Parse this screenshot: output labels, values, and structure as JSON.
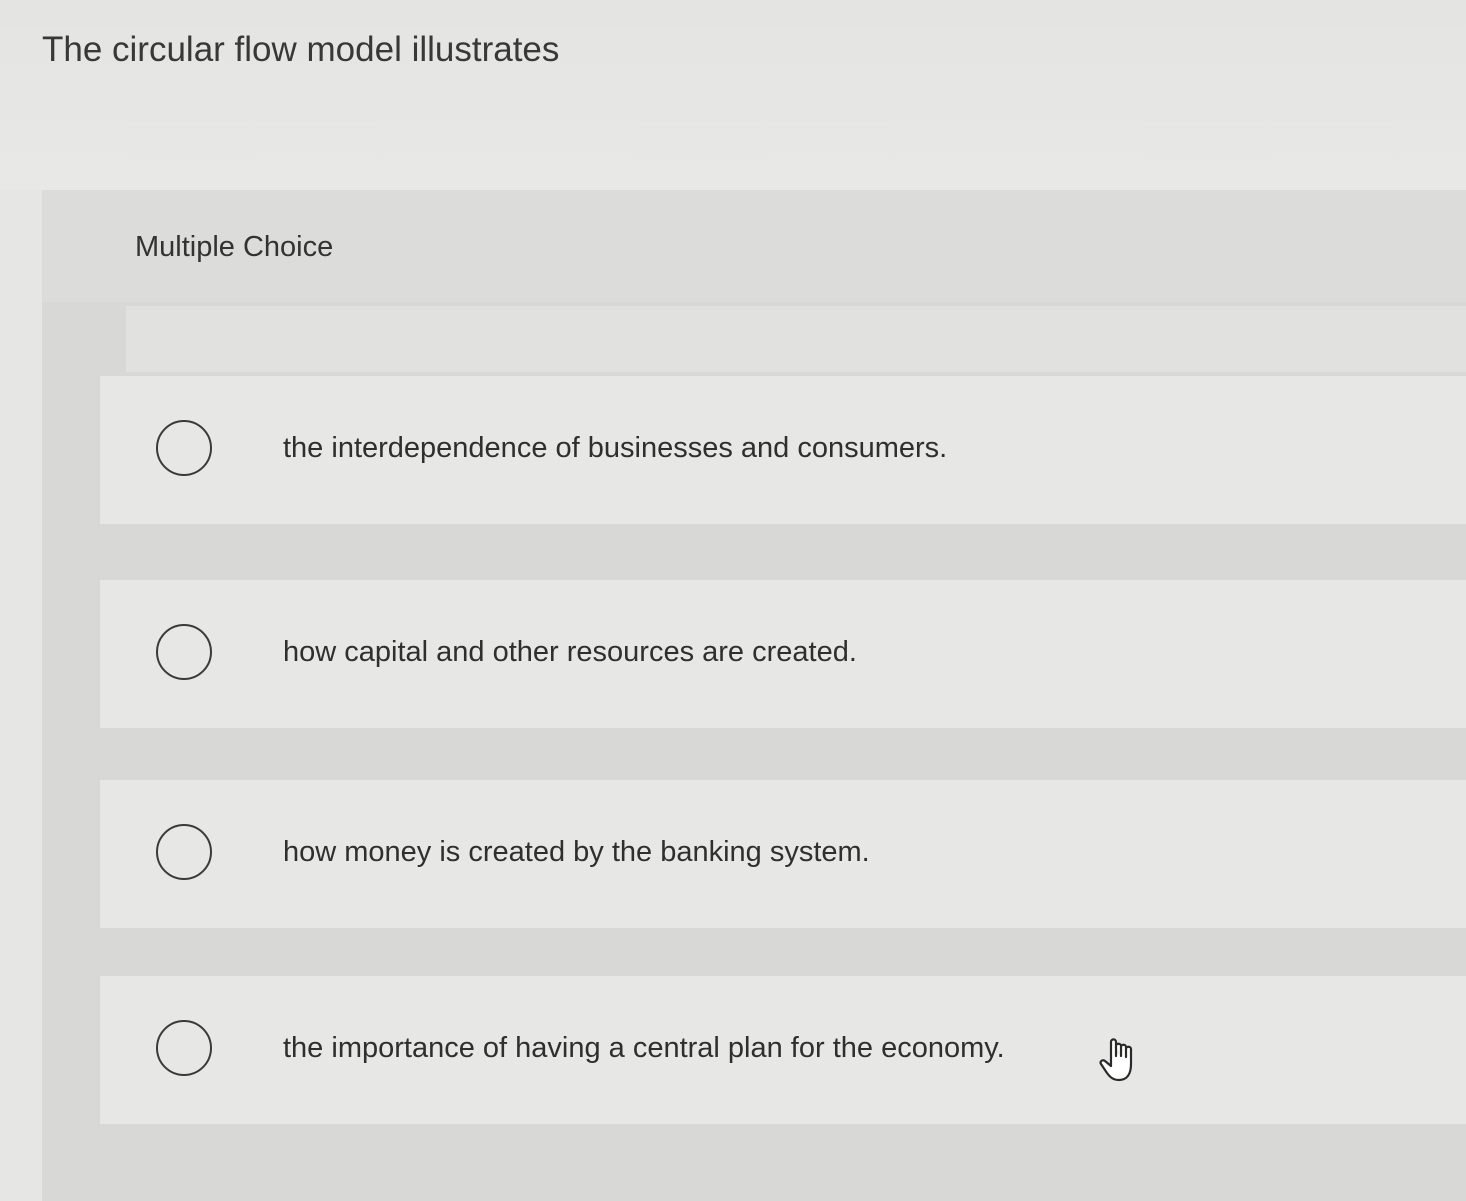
{
  "question": {
    "text": "The circular flow model illustrates"
  },
  "question_type": {
    "label": "Multiple Choice"
  },
  "choices": [
    {
      "label": "the interdependence of businesses and consumers.",
      "selected": false
    },
    {
      "label": "how capital and other resources are created.",
      "selected": false
    },
    {
      "label": "how money is created by the banking system.",
      "selected": false
    },
    {
      "label": "the importance of having a central plan for the economy.",
      "selected": false
    }
  ],
  "cursor": {
    "icon": "hand-pointer-icon"
  }
}
